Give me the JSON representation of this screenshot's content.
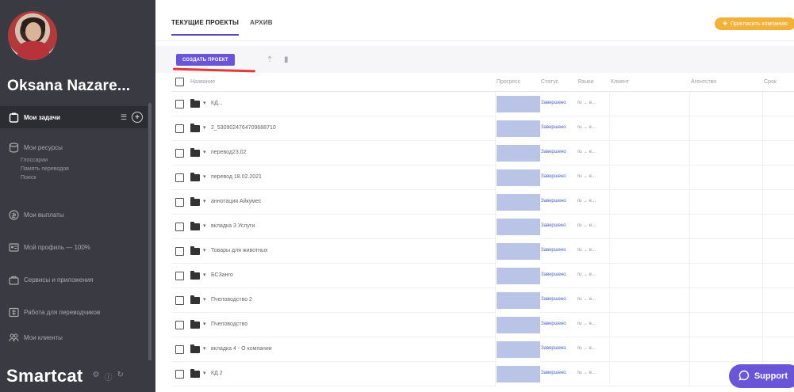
{
  "user": {
    "name": "Oksana Nazare..."
  },
  "sidebar": {
    "items": [
      {
        "label": "Мои задачи",
        "icon": "tasks-icon",
        "active": true
      },
      {
        "label": "Мои ресурсы",
        "icon": "resources-icon",
        "active": false
      },
      {
        "label": "Мои выплаты",
        "icon": "payouts-icon",
        "active": false
      },
      {
        "label": "Мой профиль — 100%",
        "icon": "profile-icon",
        "active": false
      },
      {
        "label": "Сервисы и приложения",
        "icon": "services-icon",
        "active": false
      },
      {
        "label": "Работа для переводчиков",
        "icon": "jobs-icon",
        "active": false
      },
      {
        "label": "Мои клиенты",
        "icon": "clients-icon",
        "active": false
      }
    ],
    "sub_items": [
      "Глоссарии",
      "Память переводов",
      "Поиск"
    ]
  },
  "brand": {
    "name": "Smartcat"
  },
  "tabs": [
    {
      "label": "ТЕКУЩИЕ ПРОЕКТЫ",
      "active": true
    },
    {
      "label": "АРХИВ",
      "active": false
    }
  ],
  "promo": {
    "label": "Пригласить компанию"
  },
  "toolbar": {
    "create_label": "СОЗДАТЬ ПРОЕКТ"
  },
  "table": {
    "columns": [
      "Название",
      "Прогресс",
      "Статус",
      "Языки",
      "Клиент",
      "Агентство",
      "Срок"
    ],
    "rows": [
      {
        "name": "КД...",
        "status": "Завершено",
        "langs": "ru → e...",
        "progress": 1
      },
      {
        "name": "2_5309024764709688710",
        "status": "Завершено",
        "langs": "ru → e...",
        "progress": 1
      },
      {
        "name": "перевод23.02",
        "status": "Завершено",
        "langs": "ru → e...",
        "progress": 1
      },
      {
        "name": "перевод 18.02.2021",
        "status": "Завершено",
        "langs": "ru → e...",
        "progress": 1
      },
      {
        "name": "аннотация Айкумес",
        "status": "Завершено",
        "langs": "ru → e...",
        "progress": 1
      },
      {
        "name": "вкладка 3 Услуги",
        "status": "Завершено",
        "langs": "ru → e...",
        "progress": 1
      },
      {
        "name": "Товары для животных",
        "status": "Завершено",
        "langs": "ru → e...",
        "progress": 1
      },
      {
        "name": "БСЗанго",
        "status": "Завершено",
        "langs": "ru → e...",
        "progress": 1
      },
      {
        "name": "Пчеловодство 2",
        "status": "Завершено",
        "langs": "ru → e...",
        "progress": 1
      },
      {
        "name": "Пчеловодство",
        "status": "Завершено",
        "langs": "ru → e...",
        "progress": 1
      },
      {
        "name": "вкладка 4 - О компании",
        "status": "Завершено",
        "langs": "ru → e...",
        "progress": 1
      },
      {
        "name": "КД 2",
        "status": "Завершено",
        "langs": "ru → e...",
        "progress": 1
      }
    ]
  },
  "support": {
    "label": "Support"
  },
  "colors": {
    "accent": "#6a55d8",
    "sidebar": "#3a3a42",
    "progress": "#b9c4e6",
    "status": "#4b5fc7",
    "promo": "#f2b23a"
  }
}
